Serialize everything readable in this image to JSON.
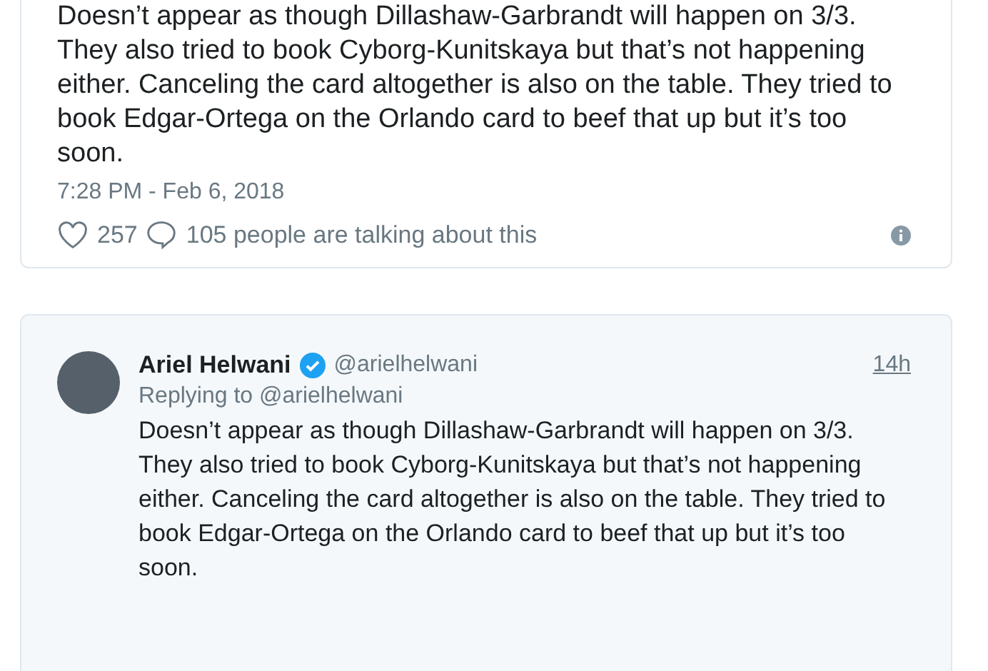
{
  "main_tweet": {
    "text": "Doesn’t appear as though Dillashaw-Garbrandt will happen on 3/3. They also tried to book Cyborg-Kunitskaya but that’s not happening either. Canceling the card altogether is also on the table. They tried to book Edgar-Ortega on the Orlando card to beef that up but it’s too soon.",
    "timestamp": "7:28 PM - Feb 6, 2018",
    "likes": "257",
    "talking": "105 people are talking about this"
  },
  "reply_tweet": {
    "name": "Ariel Helwani",
    "verified": true,
    "handle": "@arielhelwani",
    "time": "14h",
    "replying_to": "Replying to @arielhelwani",
    "text": "Doesn’t appear as though Dillashaw-Garbrandt will happen on 3/3. They also tried to book Cyborg-Kunitskaya but that’s not happening either. Canceling the card altogether is also on the table. They tried to book Edgar-Ortega on the Orlando card to beef that up but it’s too soon."
  }
}
